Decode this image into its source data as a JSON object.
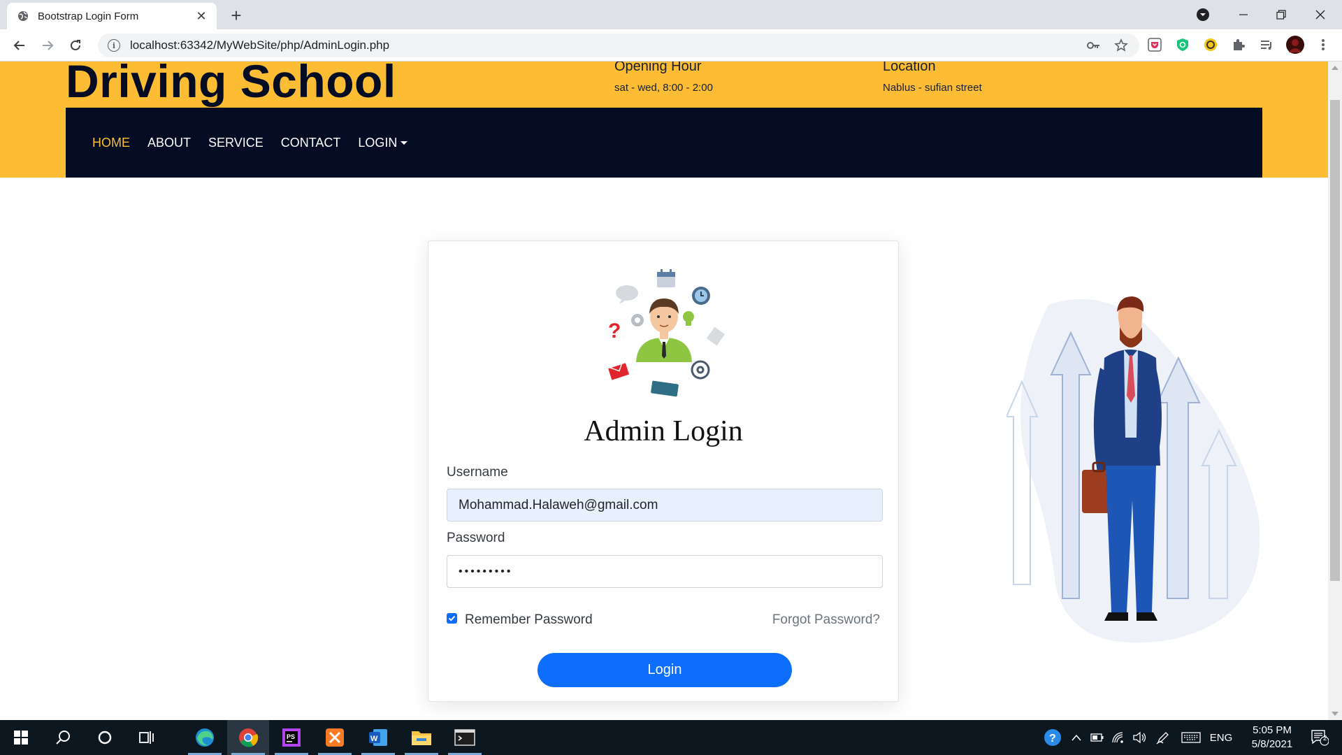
{
  "browser": {
    "tab_title": "Bootstrap Login Form",
    "url": "localhost:63342/MyWebSite/php/AdminLogin.php"
  },
  "site": {
    "brand": "Driving School",
    "opening": {
      "heading": "Opening Hour",
      "value": "sat - wed, 8:00 - 2:00"
    },
    "location": {
      "heading": "Location",
      "value": "Nablus - sufian street"
    },
    "nav": {
      "home": "HOME",
      "about": "ABOUT",
      "service": "SERVICE",
      "contact": "CONTACT",
      "login": "LOGIN"
    }
  },
  "login": {
    "title": "Admin Login",
    "username_label": "Username",
    "username_value": "Mohammad.Halaweh@gmail.com",
    "password_label": "Password",
    "password_masked": "•••••••••",
    "remember_label": "Remember Password",
    "remember_checked": true,
    "forgot_label": "Forgot Password?",
    "button_label": "Login"
  },
  "taskbar": {
    "language": "ENG",
    "time": "5:05 PM",
    "date": "5/8/2021",
    "notification_count": "2"
  },
  "colors": {
    "header_yellow": "#fcbd34",
    "navbar_dark": "#030c22",
    "primary_blue": "#0d6efd"
  }
}
